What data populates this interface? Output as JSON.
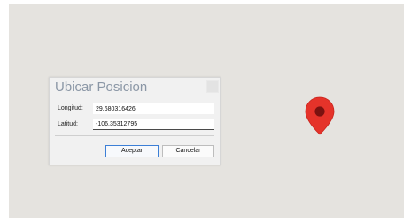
{
  "dialog": {
    "title": "Ubicar Posicion",
    "longitude_label": "Longitud:",
    "longitude_value": "29.680316426",
    "latitude_label": "Latitud:",
    "latitude_value": "-106.35312795",
    "accept_label": "Aceptar",
    "cancel_label": "Cancelar"
  },
  "map": {
    "marker_icon": "map-pin-icon",
    "marker_color": "#e5332a",
    "marker_dot_color": "#7a1210",
    "background_color": "#e5e3df"
  }
}
